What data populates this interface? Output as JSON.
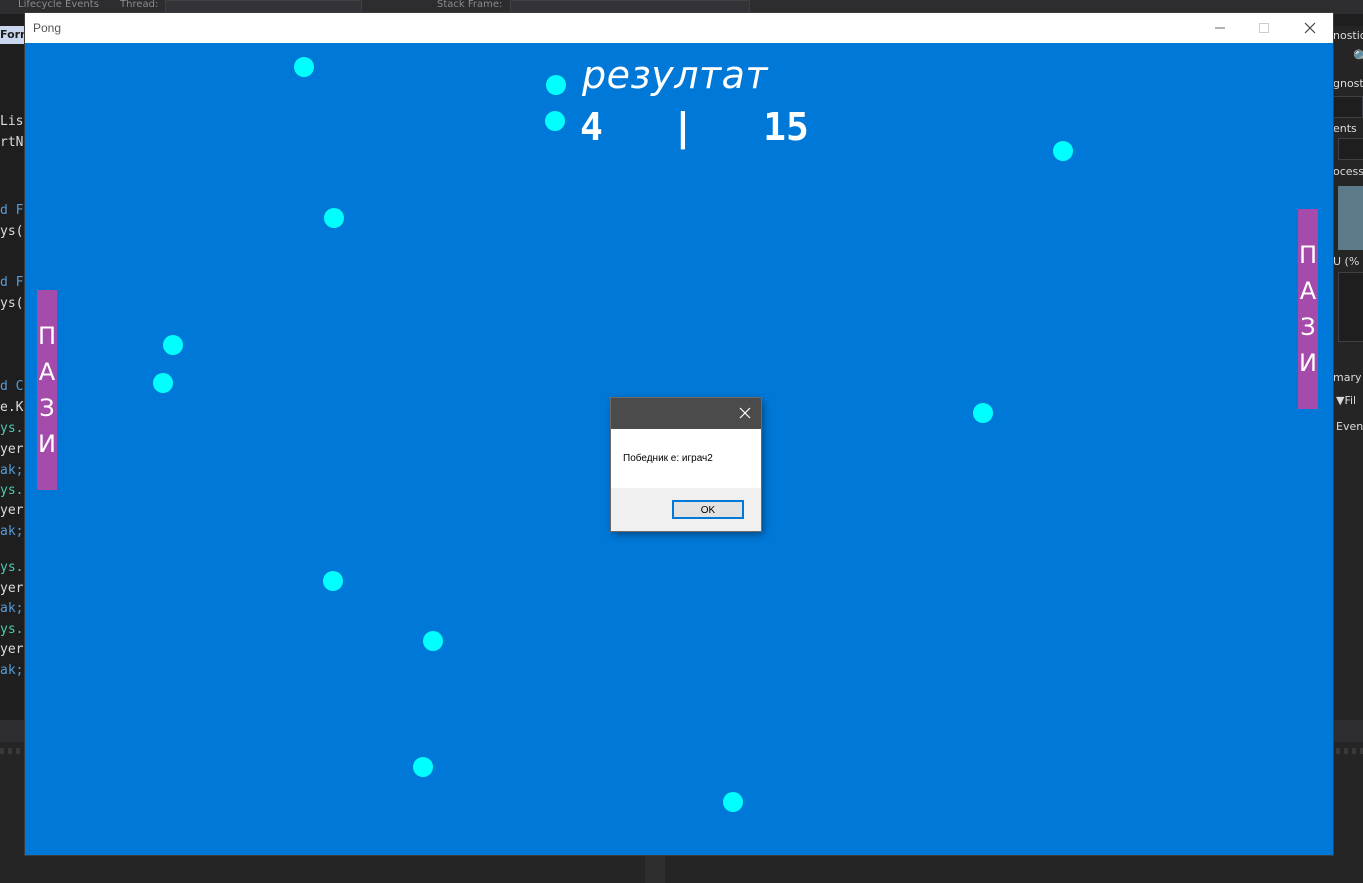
{
  "ide": {
    "toolbar": {
      "lifecycle_label": "Lifecycle Events",
      "thread_label": "Thread:",
      "stack_frame_label": "Stack Frame:"
    },
    "tab_label": "Form",
    "code_fragments": [
      "List",
      "rtN",
      "d F",
      "ys(",
      "d F",
      "ys(",
      "d C",
      "e.K",
      "ys.",
      "yer",
      "ak;",
      "ys.",
      "yer",
      "ak;",
      "ys.",
      "yer",
      "ak;",
      "ys.",
      "yer",
      "ak;"
    ],
    "right_panel": {
      "diagnostics": "nostic",
      "diagnostics2": "gnostic",
      "events": "ents",
      "process": "ocess",
      "cpu": "U (%",
      "summary": "mary",
      "filter": "Fil",
      "events2": "Event"
    }
  },
  "window": {
    "title": "Pong",
    "minimize_icon": "minimize-icon",
    "maximize_icon": "maximize-icon",
    "close_icon": "close-icon"
  },
  "game": {
    "background_color": "#0078d7",
    "ball_color": "#00ffff",
    "paddle_color": "#a44bab",
    "score_title": "резултат",
    "score_left": "4",
    "score_separator": "|",
    "score_right": "15",
    "paddle_left_letters": [
      "П",
      "А",
      "З",
      "И"
    ],
    "paddle_right_letters": [
      "П",
      "А",
      "З",
      "И"
    ]
  },
  "dialog": {
    "message": "Победник е: играч2",
    "ok_label": "OK",
    "close_icon": "close-icon"
  }
}
